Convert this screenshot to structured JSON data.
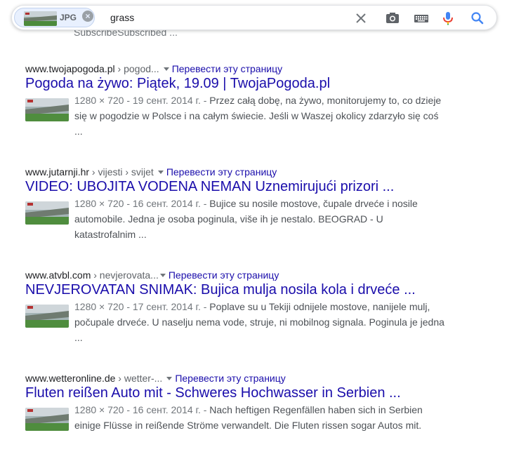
{
  "search": {
    "chip_label": "JPG",
    "chip_close": "×",
    "query": "grass",
    "clear_icon": "close-icon",
    "camera_icon": "camera-icon",
    "keyboard_icon": "keyboard-icon",
    "mic_icon": "mic-icon",
    "search_icon": "search-icon"
  },
  "partial_previous_snippet": "SubscribeSubscribed ...",
  "translate_label": "Перевести эту страницу",
  "results": [
    {
      "domain": "www.twojapogoda.pl",
      "path": " › pogod...",
      "title": "Pogoda na żywo: Piątek, 19.09 | TwojaPogoda.pl",
      "meta": "1280 × 720 - 19 сент. 2014 г. - ",
      "snippet": "Przez całą dobę, na żywo, monitorujemy to, co dzieje się w pogodzie w Polsce i na całym świecie. Jeśli w Waszej okolicy zdarzyło się coś ..."
    },
    {
      "domain": "www.jutarnji.hr",
      "path": " › vijesti › svijet",
      "title": "VIDEO: UBOJITA VODENA NEMAN Uznemirujući prizori ...",
      "meta": "1280 × 720 - 16 сент. 2014 г. - ",
      "snippet": "Bujice su nosile mostove, čupale drveće i nosile automobile. Jedna je osoba poginula, više ih je nestalo. BEOGRAD - U katastrofalnim ..."
    },
    {
      "domain": "www.atvbl.com",
      "path": " › nevjerovata...",
      "title": "NEVJEROVATAN SNIMAK: Bujica mulja nosila kola i drveće ...",
      "meta": "1280 × 720 - 17 сент. 2014 г. - ",
      "snippet": "Poplave su u Tekiji odnijele mostove, nanijele mulj, počupale drveće. U naselju nema vode, struje, ni mobilnog signala. Poginula je jedna ..."
    },
    {
      "domain": "www.wetteronline.de",
      "path": " › wetter-...",
      "title": "Fluten reißen Auto mit - Schweres Hochwasser in Serbien ...",
      "meta": "1280 × 720 - 16 сент. 2014 г. - ",
      "snippet": "Nach heftigen Regenfällen haben sich in Serbien einige Flüsse in reißende Ströme verwandelt. Die Fluten rissen sogar Autos mit."
    }
  ],
  "colors": {
    "link": "#1a0dab",
    "text": "#4d5156",
    "meta": "#70757a",
    "mic_blue": "#4285f4",
    "mic_red": "#ea4335",
    "search_blue": "#4285f4"
  }
}
